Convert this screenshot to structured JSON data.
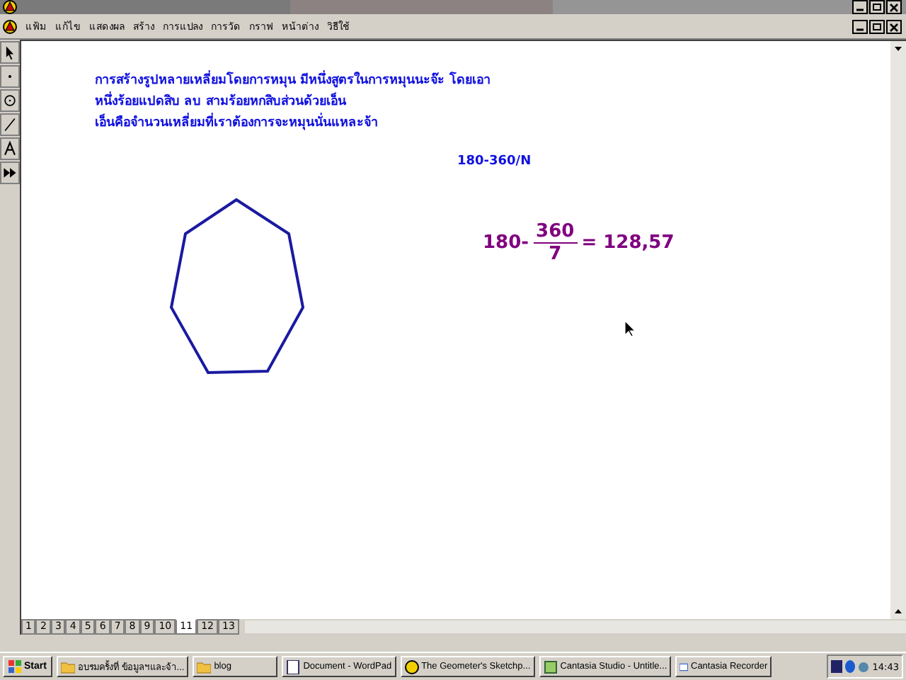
{
  "menu": [
    "แฟ้ม",
    "แก้ไข",
    "แสดงผล",
    "สร้าง",
    "การแปลง",
    "การวัด",
    "กราฟ",
    "หน้าต่าง",
    "วิธีใช้"
  ],
  "canvas": {
    "text_lines": [
      "การสร้างรูปหลายเหลี่ยมโดยการหมุน  มีหนึ่งสูตรในการหมุนนะจ๊ะ โดยเอา",
      "หนึ่งร้อยแปดสิบ ลบ สามร้อยหกสิบส่วนด้วยเอ็น",
      "เอ็นคือจำนวนเหลี่ยมที่เราต้องการจะหมุนนั่นแหละจ้า"
    ],
    "formula_label": "180-360/N",
    "equation": {
      "left": "180-",
      "numerator": "360",
      "denominator": "7",
      "result": "= 128,57"
    }
  },
  "page_tabs": [
    {
      "label": "1",
      "selected": false
    },
    {
      "label": "2",
      "selected": false
    },
    {
      "label": "3",
      "selected": false
    },
    {
      "label": "4",
      "selected": false
    },
    {
      "label": "5",
      "selected": false
    },
    {
      "label": "6",
      "selected": false
    },
    {
      "label": "7",
      "selected": false
    },
    {
      "label": "8",
      "selected": false
    },
    {
      "label": "9",
      "selected": false
    },
    {
      "label": "10",
      "selected": false
    },
    {
      "label": "11",
      "selected": true
    },
    {
      "label": "12",
      "selected": false
    },
    {
      "label": "13",
      "selected": false
    }
  ],
  "taskbar": {
    "start": "Start",
    "tasks": [
      {
        "label": "อบรมครั้งที่ ข้อมูลฯและจ้า..."
      },
      {
        "label": "blog"
      },
      {
        "label": "Document - WordPad"
      },
      {
        "label": "The Geometer's Sketchp..."
      },
      {
        "label": "Cantasia Studio - Untitle..."
      },
      {
        "label": "Cantasia Recorder"
      }
    ],
    "clock": "14:43"
  }
}
